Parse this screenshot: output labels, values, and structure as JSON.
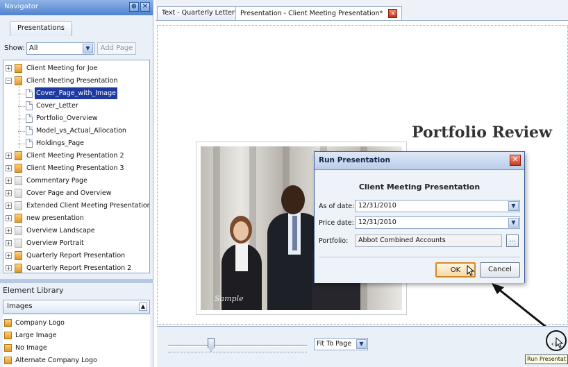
{
  "navigator": {
    "title": "Navigator",
    "pin_glyph": "⊕",
    "close_glyph": "✕",
    "tab": "Presentations",
    "show_label": "Show:",
    "show_value": "All",
    "add_page": "Add Page",
    "tree": [
      {
        "label": "Client Meeting for Joe",
        "level": 0,
        "expander": "+",
        "icon": "folder"
      },
      {
        "label": "Client Meeting Presentation",
        "level": 0,
        "expander": "−",
        "icon": "folder"
      },
      {
        "label": "Cover_Page_with_Image",
        "level": 1,
        "icon": "page",
        "selected": true
      },
      {
        "label": "Cover_Letter",
        "level": 1,
        "icon": "page"
      },
      {
        "label": "Portfolio_Overview",
        "level": 1,
        "icon": "page"
      },
      {
        "label": "Model_vs_Actual_Allocation",
        "level": 1,
        "icon": "page"
      },
      {
        "label": "Holdings_Page",
        "level": 1,
        "icon": "page"
      },
      {
        "label": "Client Meeting Presentation 2",
        "level": 0,
        "expander": "+",
        "icon": "folder"
      },
      {
        "label": "Client Meeting Presentation 3",
        "level": 0,
        "expander": "+",
        "icon": "folder"
      },
      {
        "label": "Commentary Page",
        "level": 0,
        "expander": "+",
        "icon": "grey"
      },
      {
        "label": "Cover Page and Overview",
        "level": 0,
        "expander": "+",
        "icon": "grey"
      },
      {
        "label": "Extended Client Meeting Presentation",
        "level": 0,
        "expander": "+",
        "icon": "grey"
      },
      {
        "label": "new presentation",
        "level": 0,
        "expander": "+",
        "icon": "folder"
      },
      {
        "label": "Overview Landscape",
        "level": 0,
        "expander": "+",
        "icon": "grey"
      },
      {
        "label": "Overview Portrait",
        "level": 0,
        "expander": "+",
        "icon": "grey"
      },
      {
        "label": "Quarterly Report Presentation",
        "level": 0,
        "expander": "+",
        "icon": "folder"
      },
      {
        "label": "Quarterly Report Presentation 2",
        "level": 0,
        "expander": "+",
        "icon": "folder"
      }
    ]
  },
  "element_library": {
    "title": "Element Library",
    "category": "Images",
    "collapse_glyph": "▲",
    "items": [
      "Company Logo",
      "Large Image",
      "No Image",
      "Alternate Company Logo"
    ]
  },
  "doc_tabs": [
    {
      "label": "Text - Quarterly Letter*"
    },
    {
      "label": "Presentation - Client Meeting Presentation*",
      "active": true,
      "close_glyph": "✕"
    }
  ],
  "slide": {
    "title": "Portfolio Review",
    "photo_watermark": "Sample"
  },
  "dialog": {
    "title": "Run Presentation",
    "close_glyph": "✕",
    "heading": "Client Meeting Presentation",
    "as_of_label": "As of date:",
    "as_of_value": "12/31/2010",
    "price_label": "Price date:",
    "price_value": "12/31/2010",
    "portfolio_label": "Portfolio:",
    "portfolio_value": "Abbot Combined Accounts",
    "browse_glyph": "...",
    "ok": "OK",
    "cancel": "Cancel"
  },
  "bottom": {
    "fit_value": "Fit To Page",
    "dropdown_glyph": "▼",
    "run_glyph": "‹›",
    "tooltip": "Run Presentat",
    "zoom_level": 0.3
  },
  "colors": {
    "selection": "#1e3aa0",
    "title_bar": "#4f83cf",
    "ok_border": "#d08a24"
  }
}
